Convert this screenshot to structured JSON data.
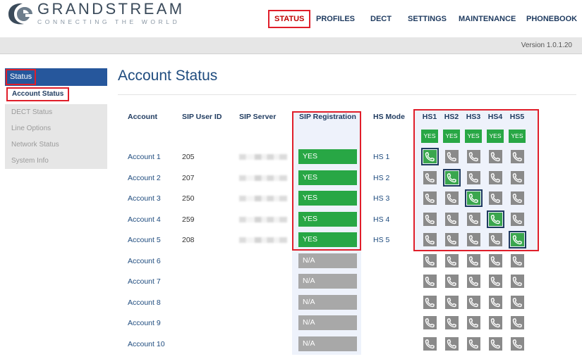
{
  "header": {
    "brand_name": "GRANDSTREAM",
    "brand_tagline": "CONNECTING THE WORLD",
    "logo_icon": "grandstream-swoosh-icon",
    "nav": [
      {
        "label": "STATUS",
        "active": true
      },
      {
        "label": "PROFILES",
        "active": false
      },
      {
        "label": "DECT",
        "active": false
      },
      {
        "label": "SETTINGS",
        "active": false
      },
      {
        "label": "MAINTENANCE",
        "active": false
      },
      {
        "label": "PHONEBOOK",
        "active": false
      }
    ],
    "version": "Version 1.0.1.20"
  },
  "sidebar": {
    "section": "Status",
    "items": [
      {
        "label": "Account Status",
        "active": true
      },
      {
        "label": "DECT Status",
        "active": false
      },
      {
        "label": "Line Options",
        "active": false
      },
      {
        "label": "Network Status",
        "active": false
      },
      {
        "label": "System Info",
        "active": false
      }
    ]
  },
  "main": {
    "title": "Account Status",
    "columns": {
      "account": "Account",
      "sip_user_id": "SIP User ID",
      "sip_server": "SIP Server",
      "sip_registration": "SIP Registration",
      "hs_mode": "HS Mode",
      "handsets": [
        "HS1",
        "HS2",
        "HS3",
        "HS4",
        "HS5"
      ]
    },
    "handset_status": [
      "YES",
      "YES",
      "YES",
      "YES",
      "YES"
    ],
    "rows": [
      {
        "account": "Account 1",
        "sip_user_id": "205",
        "server_blurred": true,
        "registration": "YES",
        "hs_mode": "HS 1",
        "active_hs": 1
      },
      {
        "account": "Account 2",
        "sip_user_id": "207",
        "server_blurred": true,
        "registration": "YES",
        "hs_mode": "HS 2",
        "active_hs": 2
      },
      {
        "account": "Account 3",
        "sip_user_id": "250",
        "server_blurred": true,
        "registration": "YES",
        "hs_mode": "HS 3",
        "active_hs": 3
      },
      {
        "account": "Account 4",
        "sip_user_id": "259",
        "server_blurred": true,
        "registration": "YES",
        "hs_mode": "HS 4",
        "active_hs": 4
      },
      {
        "account": "Account 5",
        "sip_user_id": "208",
        "server_blurred": true,
        "registration": "YES",
        "hs_mode": "HS 5",
        "active_hs": 5
      },
      {
        "account": "Account 6",
        "sip_user_id": "",
        "server_blurred": false,
        "registration": "N/A",
        "hs_mode": "",
        "active_hs": 0
      },
      {
        "account": "Account 7",
        "sip_user_id": "",
        "server_blurred": false,
        "registration": "N/A",
        "hs_mode": "",
        "active_hs": 0
      },
      {
        "account": "Account 8",
        "sip_user_id": "",
        "server_blurred": false,
        "registration": "N/A",
        "hs_mode": "",
        "active_hs": 0
      },
      {
        "account": "Account 9",
        "sip_user_id": "",
        "server_blurred": false,
        "registration": "N/A",
        "hs_mode": "",
        "active_hs": 0
      },
      {
        "account": "Account 10",
        "sip_user_id": "",
        "server_blurred": false,
        "registration": "N/A",
        "hs_mode": "",
        "active_hs": 0
      }
    ],
    "phone_icon": "phone-handset-icon"
  },
  "colors": {
    "brand_blue": "#26579c",
    "title_blue": "#1e4b7e",
    "yes_green": "#28a745",
    "na_gray": "#a8a8a8",
    "highlight_red": "#e01e2a",
    "panel_tint": "#eef2fb"
  }
}
